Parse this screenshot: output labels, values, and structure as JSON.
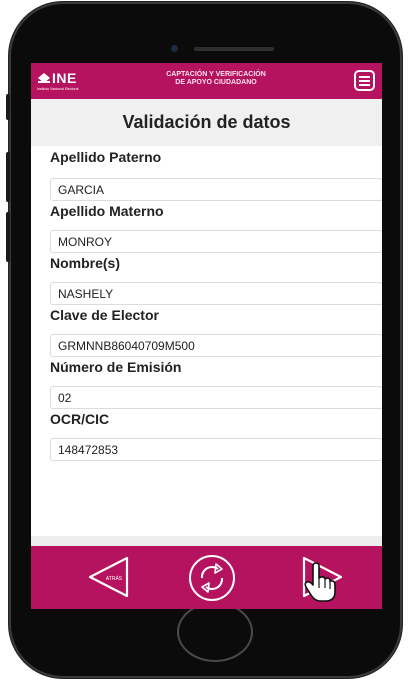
{
  "app": {
    "logo_text": "INE",
    "logo_subtext": "Instituto Nacional Electoral",
    "header_title_line1": "CAPTACIÓN Y VERIFICACIÓN",
    "header_title_line2": "DE APOYO CIUDADANO",
    "menu_icon": "hamburger-icon",
    "accent_color": "#b5125f"
  },
  "page": {
    "title": "Validación de datos"
  },
  "form": {
    "fields": [
      {
        "label": "Apellido Paterno",
        "value": "GARCIA"
      },
      {
        "label": "Apellido Materno",
        "value": "MONROY"
      },
      {
        "label": "Nombre(s)",
        "value": "NASHELY"
      },
      {
        "label": "Clave de Elector",
        "value": "GRMNNB86040709M500"
      },
      {
        "label": "Número de Emisión",
        "value": "02"
      },
      {
        "label": "OCR/CIC",
        "value": "148472853"
      }
    ]
  },
  "nav": {
    "back_label": "ATRÁS",
    "back_icon": "triangle-left-icon",
    "refresh_icon": "refresh-icon",
    "next_icon": "triangle-right-icon",
    "cursor_icon": "hand-pointer-icon"
  }
}
